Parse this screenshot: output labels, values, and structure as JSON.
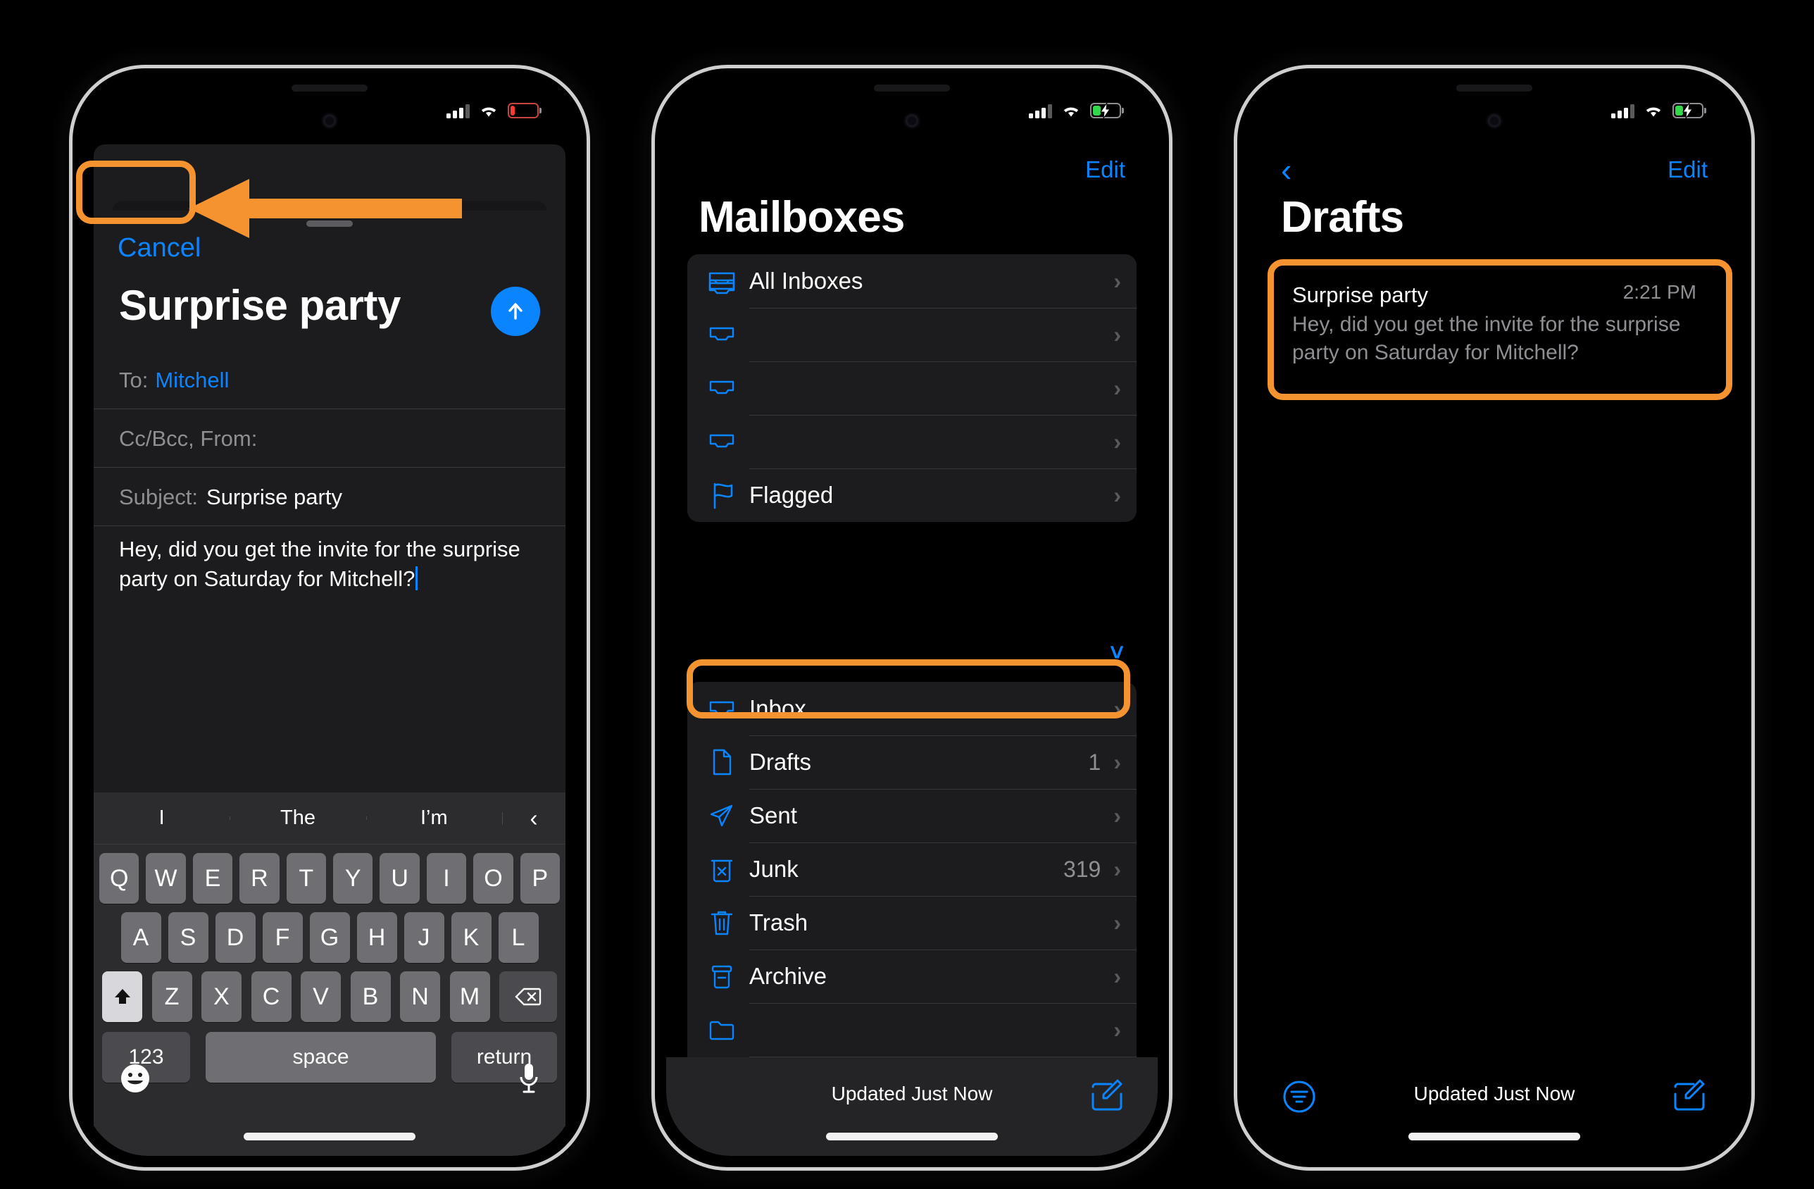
{
  "phones": [
    {
      "id": "compose",
      "status": {
        "signal": "cellular-signal",
        "wifi": "wifi-icon",
        "battery": "battery-low"
      },
      "compose": {
        "cancel_label": "Cancel",
        "title": "Surprise party",
        "send_icon": "send-arrow-up-icon",
        "to_label": "To:",
        "to_value": "Mitchell",
        "ccbcc_label": "Cc/Bcc, From:",
        "subject_label": "Subject:",
        "subject_value": "Surprise party",
        "body": "Hey, did you get the invite for the surprise party on Saturday for Mitchell?"
      },
      "keyboard": {
        "predictions": [
          "I",
          "The",
          "I’m"
        ],
        "collapse_icon": "chevron-left-icon",
        "row1": [
          "Q",
          "W",
          "E",
          "R",
          "T",
          "Y",
          "U",
          "I",
          "O",
          "P"
        ],
        "row2": [
          "A",
          "S",
          "D",
          "F",
          "G",
          "H",
          "J",
          "K",
          "L"
        ],
        "row3": [
          "Z",
          "X",
          "C",
          "V",
          "B",
          "N",
          "M"
        ],
        "shift_icon": "shift-up-arrow-icon",
        "backspace_icon": "backspace-delete-icon",
        "numbers_label": "123",
        "space_label": "space",
        "return_label": "return",
        "emoji_icon": "emoji-smiley-icon",
        "dictation_icon": "microphone-icon"
      }
    },
    {
      "id": "mailboxes",
      "status": {
        "signal": "cellular-signal",
        "wifi": "wifi-icon",
        "battery": "battery-charging"
      },
      "nav": {
        "edit_label": "Edit"
      },
      "title": "Mailboxes",
      "group_top": [
        {
          "icon": "all-inboxes-icon",
          "label": "All Inboxes",
          "count": ""
        },
        {
          "icon": "inbox-icon",
          "label": "",
          "count": ""
        },
        {
          "icon": "inbox-icon",
          "label": "",
          "count": ""
        },
        {
          "icon": "inbox-icon",
          "label": "",
          "count": ""
        },
        {
          "icon": "flag-icon",
          "label": "Flagged",
          "count": ""
        }
      ],
      "collapse_icon": "chevron-down-icon",
      "group_bottom": [
        {
          "icon": "inbox-icon",
          "label": "Inbox",
          "count": ""
        },
        {
          "icon": "drafts-document-icon",
          "label": "Drafts",
          "count": "1"
        },
        {
          "icon": "sent-paperplane-icon",
          "label": "Sent",
          "count": ""
        },
        {
          "icon": "junk-trash-x-icon",
          "label": "Junk",
          "count": "319"
        },
        {
          "icon": "trash-icon",
          "label": "Trash",
          "count": ""
        },
        {
          "icon": "archive-box-icon",
          "label": "Archive",
          "count": ""
        },
        {
          "icon": "folder-icon",
          "label": "",
          "count": ""
        },
        {
          "icon": "folder-icon",
          "label": "",
          "count": ""
        }
      ],
      "toolbar": {
        "status": "Updated Just Now",
        "compose_icon": "compose-pencil-icon"
      }
    },
    {
      "id": "drafts",
      "status": {
        "signal": "cellular-signal",
        "wifi": "wifi-icon",
        "battery": "battery-charging"
      },
      "nav": {
        "back_icon": "chevron-left-back-icon",
        "edit_label": "Edit"
      },
      "title": "Drafts",
      "messages": [
        {
          "time": "2:21 PM",
          "subject": "Surprise party",
          "preview": "Hey, did you get the invite for the surprise party on Saturday for Mitchell?"
        }
      ],
      "toolbar": {
        "filter_icon": "filter-lines-icon",
        "status": "Updated Just Now",
        "compose_icon": "compose-pencil-icon"
      }
    }
  ],
  "annotations": {
    "highlight_color": "#f59331",
    "cancel_highlight": "cancel-button-highlight",
    "drafts_row_highlight": "drafts-row-highlight",
    "draft_message_highlight": "draft-message-highlight",
    "pointer": "arrow-pointing-left"
  }
}
